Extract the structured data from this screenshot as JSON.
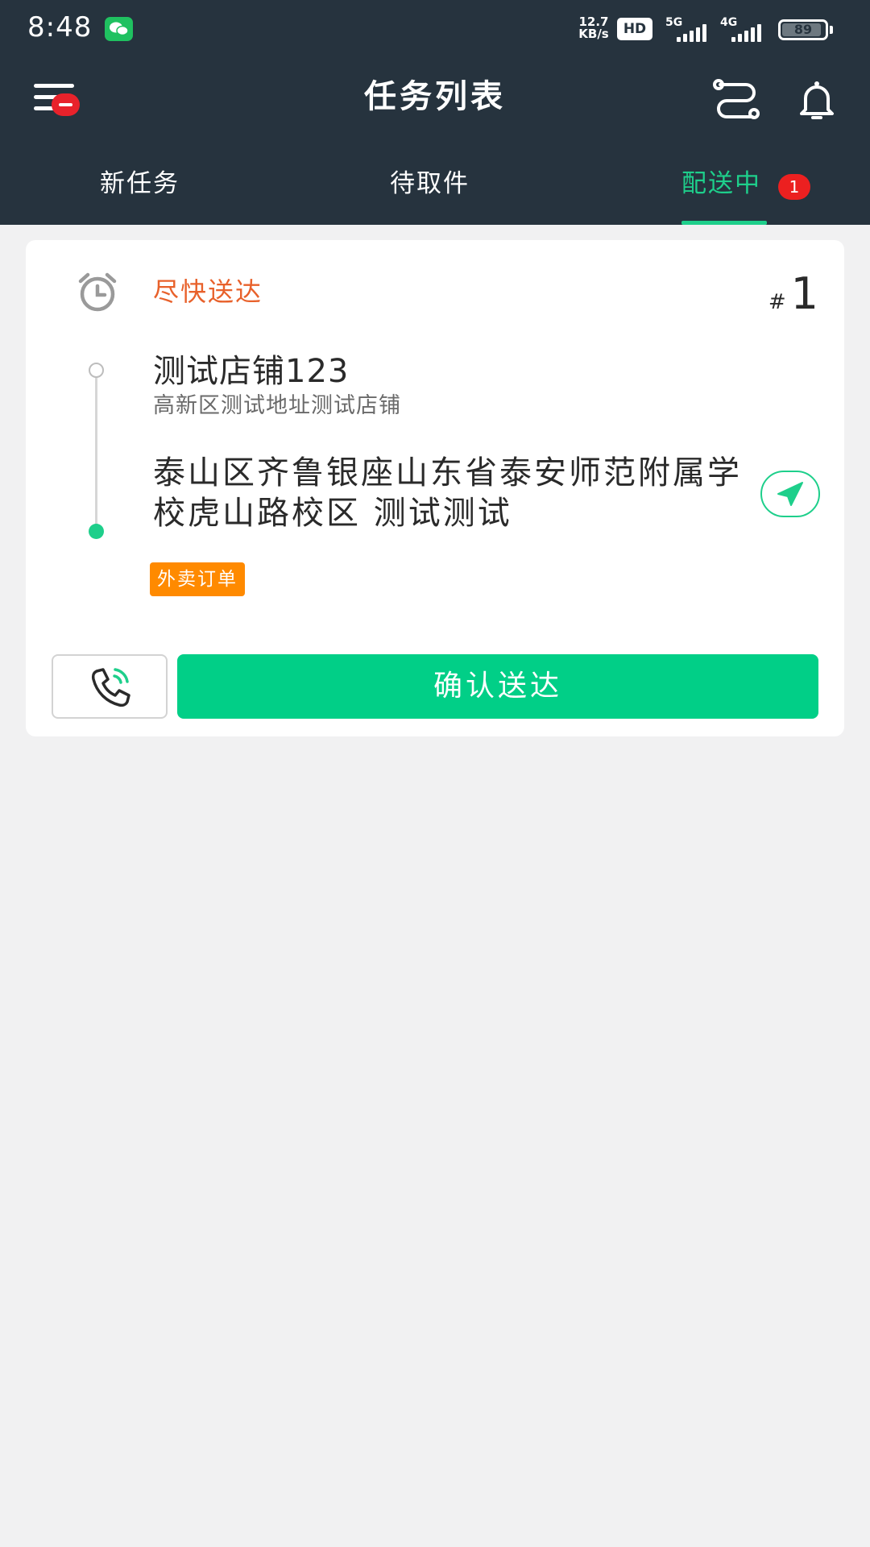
{
  "status_bar": {
    "time": "8:48",
    "net_speed_value": "12.7",
    "net_speed_unit": "KB/s",
    "hd_label": "HD",
    "network_5g": "5G",
    "network_4g": "4G",
    "battery_level": "89",
    "icons": [
      "wechat-icon",
      "signal-icon",
      "battery-icon"
    ]
  },
  "app_bar": {
    "title": "任务列表",
    "icons": [
      "menu-icon",
      "route-icon",
      "bell-icon"
    ]
  },
  "tabs": [
    {
      "label": "新任务",
      "active": false
    },
    {
      "label": "待取件",
      "active": false
    },
    {
      "label": "配送中",
      "active": true,
      "count": "1"
    }
  ],
  "task": {
    "deadline": "尽快送达",
    "order_hash": "#",
    "order_no": "1",
    "pickup_name": "测试店铺123",
    "pickup_address": "高新区测试地址测试店铺",
    "delivery_address": "泰山区齐鲁银座山东省泰安师范附属学校虎山路校区 测试测试",
    "order_type": "外卖订单",
    "confirm_label": "确认送达"
  },
  "colors": {
    "header_bg": "#26333e",
    "accent_green": "#01cf87",
    "deadline_orange": "#e8612b",
    "tag_orange": "#ff8a00",
    "badge_red": "#ec2020",
    "page_bg": "#f1f1f2"
  }
}
